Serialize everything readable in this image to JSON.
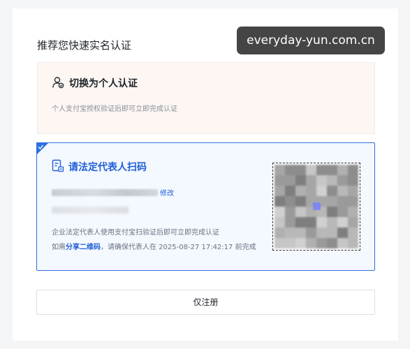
{
  "page": {
    "title": "推荐您快速实名认证"
  },
  "watermark": {
    "text": "everyday-yun.com.cn"
  },
  "personal_card": {
    "icon": "person-verify-icon",
    "title": "切换为个人认证",
    "description": "个人支付宝授权验证后即可立即完成认证"
  },
  "legal_card": {
    "icon": "document-qr-icon",
    "title": "请法定代表人扫码",
    "modify_label": "修改",
    "description": "企业法定代表人使用支付宝扫验证后即可立即完成认证",
    "note_prefix": "如需",
    "share_link": "分享二维码",
    "note_suffix": "，请确保代表人在 2025-08-27 17:42:17 前完成",
    "accent_color": "#2d6fe0"
  },
  "register_button": {
    "label": "仅注册"
  }
}
